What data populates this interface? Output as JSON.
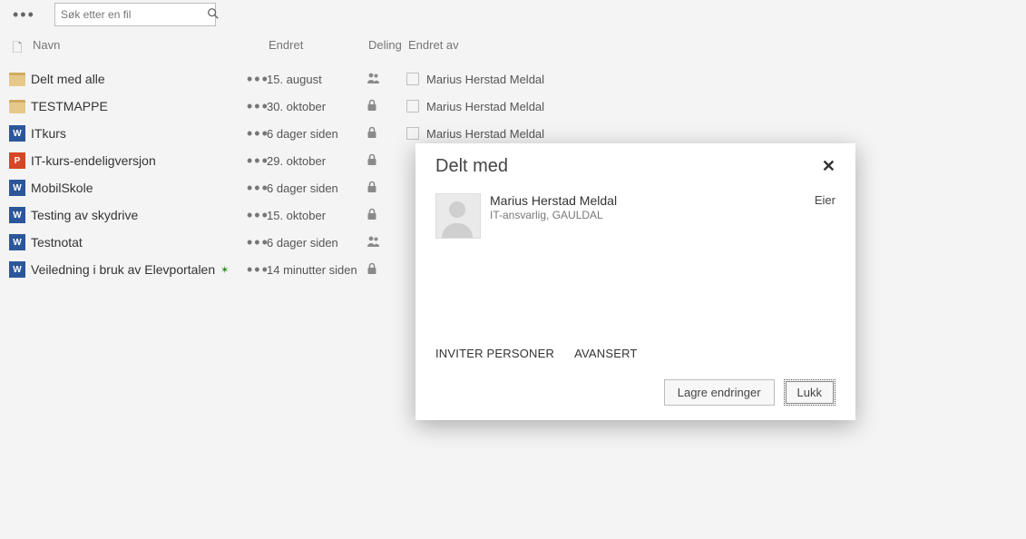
{
  "search": {
    "placeholder": "Søk etter en fil"
  },
  "headers": {
    "name": "Navn",
    "modified": "Endret",
    "sharing": "Deling",
    "modifiedBy": "Endret av"
  },
  "rows": [
    {
      "icon": "folder",
      "name": "Delt med alle",
      "modified": "15. august",
      "share": "people",
      "by": "Marius Herstad Meldal"
    },
    {
      "icon": "folder",
      "name": "TESTMAPPE",
      "modified": "30. oktober",
      "share": "lock",
      "by": "Marius Herstad Meldal"
    },
    {
      "icon": "word",
      "name": "ITkurs",
      "modified": "6 dager siden",
      "share": "lock",
      "by": "Marius Herstad Meldal"
    },
    {
      "icon": "ppt",
      "name": "IT-kurs-endeligversjon",
      "modified": "29. oktober",
      "share": "lock",
      "by": ""
    },
    {
      "icon": "word",
      "name": "MobilSkole",
      "modified": "6 dager siden",
      "share": "lock",
      "by": ""
    },
    {
      "icon": "word",
      "name": "Testing av skydrive",
      "modified": "15. oktober",
      "share": "lock",
      "by": ""
    },
    {
      "icon": "word",
      "name": "Testnotat",
      "modified": "6 dager siden",
      "share": "people",
      "by": ""
    },
    {
      "icon": "word",
      "name": "Veiledning i bruk av Elevportalen",
      "new": true,
      "modified": "14 minutter siden",
      "share": "lock",
      "by": ""
    }
  ],
  "dialog": {
    "title": "Delt med",
    "user": {
      "name": "Marius Herstad Meldal",
      "role": "IT-ansvarlig, GAULDAL",
      "permission": "Eier"
    },
    "links": {
      "invite": "INVITER PERSONER",
      "advanced": "AVANSERT"
    },
    "buttons": {
      "save": "Lagre endringer",
      "close": "Lukk"
    }
  }
}
